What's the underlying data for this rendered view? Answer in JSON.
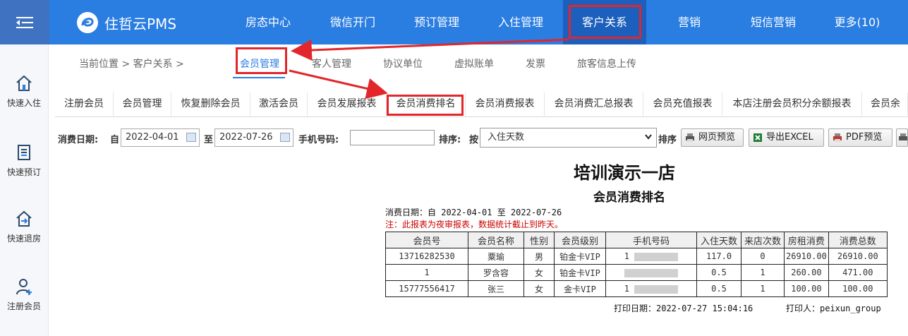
{
  "app": {
    "title": "住哲云PMS"
  },
  "topnav": [
    {
      "label": "房态中心"
    },
    {
      "label": "微信开门"
    },
    {
      "label": "预订管理"
    },
    {
      "label": "入住管理"
    },
    {
      "label": "客户关系"
    },
    {
      "label": "营销"
    },
    {
      "label": "短信营销"
    },
    {
      "label": "更多(10)"
    }
  ],
  "sidebar": [
    {
      "label": "快速入住",
      "icon": "home-icon"
    },
    {
      "label": "快速预订",
      "icon": "document-icon"
    },
    {
      "label": "快速退房",
      "icon": "checkout-icon"
    },
    {
      "label": "注册会员",
      "icon": "add-user-icon"
    }
  ],
  "breadcrumb": "当前位置 > 客户关系 >",
  "subnav": [
    {
      "label": "会员管理"
    },
    {
      "label": "客人管理"
    },
    {
      "label": "协议单位"
    },
    {
      "label": "虚拟账单"
    },
    {
      "label": "发票"
    },
    {
      "label": "旅客信息上传"
    }
  ],
  "tabs": [
    {
      "label": "注册会员"
    },
    {
      "label": "会员管理"
    },
    {
      "label": "恢复删除会员"
    },
    {
      "label": "激活会员"
    },
    {
      "label": "会员发展报表"
    },
    {
      "label": "会员消费排名"
    },
    {
      "label": "会员消费报表"
    },
    {
      "label": "会员消费汇总报表"
    },
    {
      "label": "会员充值报表"
    },
    {
      "label": "本店注册会员积分余额报表"
    },
    {
      "label": "会员余额"
    }
  ],
  "filters": {
    "date_label": "消费日期:",
    "from_label": "自",
    "from_value": "2022-04-01",
    "to_label": "至",
    "to_value": "2022-07-26",
    "phone_label": "手机号码:",
    "phone_value": "",
    "sort_label": "排序:",
    "sort_by_label": "按",
    "sort_value": "入住天数",
    "sort_tail": "排序"
  },
  "buttons": {
    "web_preview": "网页预览",
    "export_excel": "导出EXCEL",
    "pdf_preview": "PDF预览"
  },
  "report": {
    "hotel": "培训演示一店",
    "title": "会员消费排名",
    "date_range": "消费日期：自 2022-04-01 至 2022-07-26",
    "note": "注：此报表为夜审报表，数据统计截止到昨天。",
    "columns": [
      "会员号",
      "会员名称",
      "性别",
      "会员级别",
      "手机号码",
      "入住天数",
      "来店次数",
      "房租消费",
      "消费总数"
    ],
    "rows": [
      {
        "no": "13716282530",
        "name": "粟瑜",
        "gender": "男",
        "level": "铂金卡VIP",
        "phone": "1",
        "days": "117.0",
        "visits": "0",
        "rent": "26910.00",
        "total": "26910.00"
      },
      {
        "no": "1",
        "name": "罗含容",
        "gender": "女",
        "level": "铂金卡VIP",
        "phone": "",
        "days": "0.5",
        "visits": "1",
        "rent": "260.00",
        "total": "471.00"
      },
      {
        "no": "15777556417",
        "name": "张三",
        "gender": "女",
        "level": "金卡VIP",
        "phone": "1",
        "days": "0.5",
        "visits": "1",
        "rent": "100.00",
        "total": "100.00"
      }
    ],
    "print_date": "打印日期：2022-07-27 15:04:16",
    "printer": "打印人：peixun_group"
  },
  "colors": {
    "topbar": "#2a7de1",
    "active_nav": "#1c5fbd",
    "highlight": "#e2262b"
  }
}
